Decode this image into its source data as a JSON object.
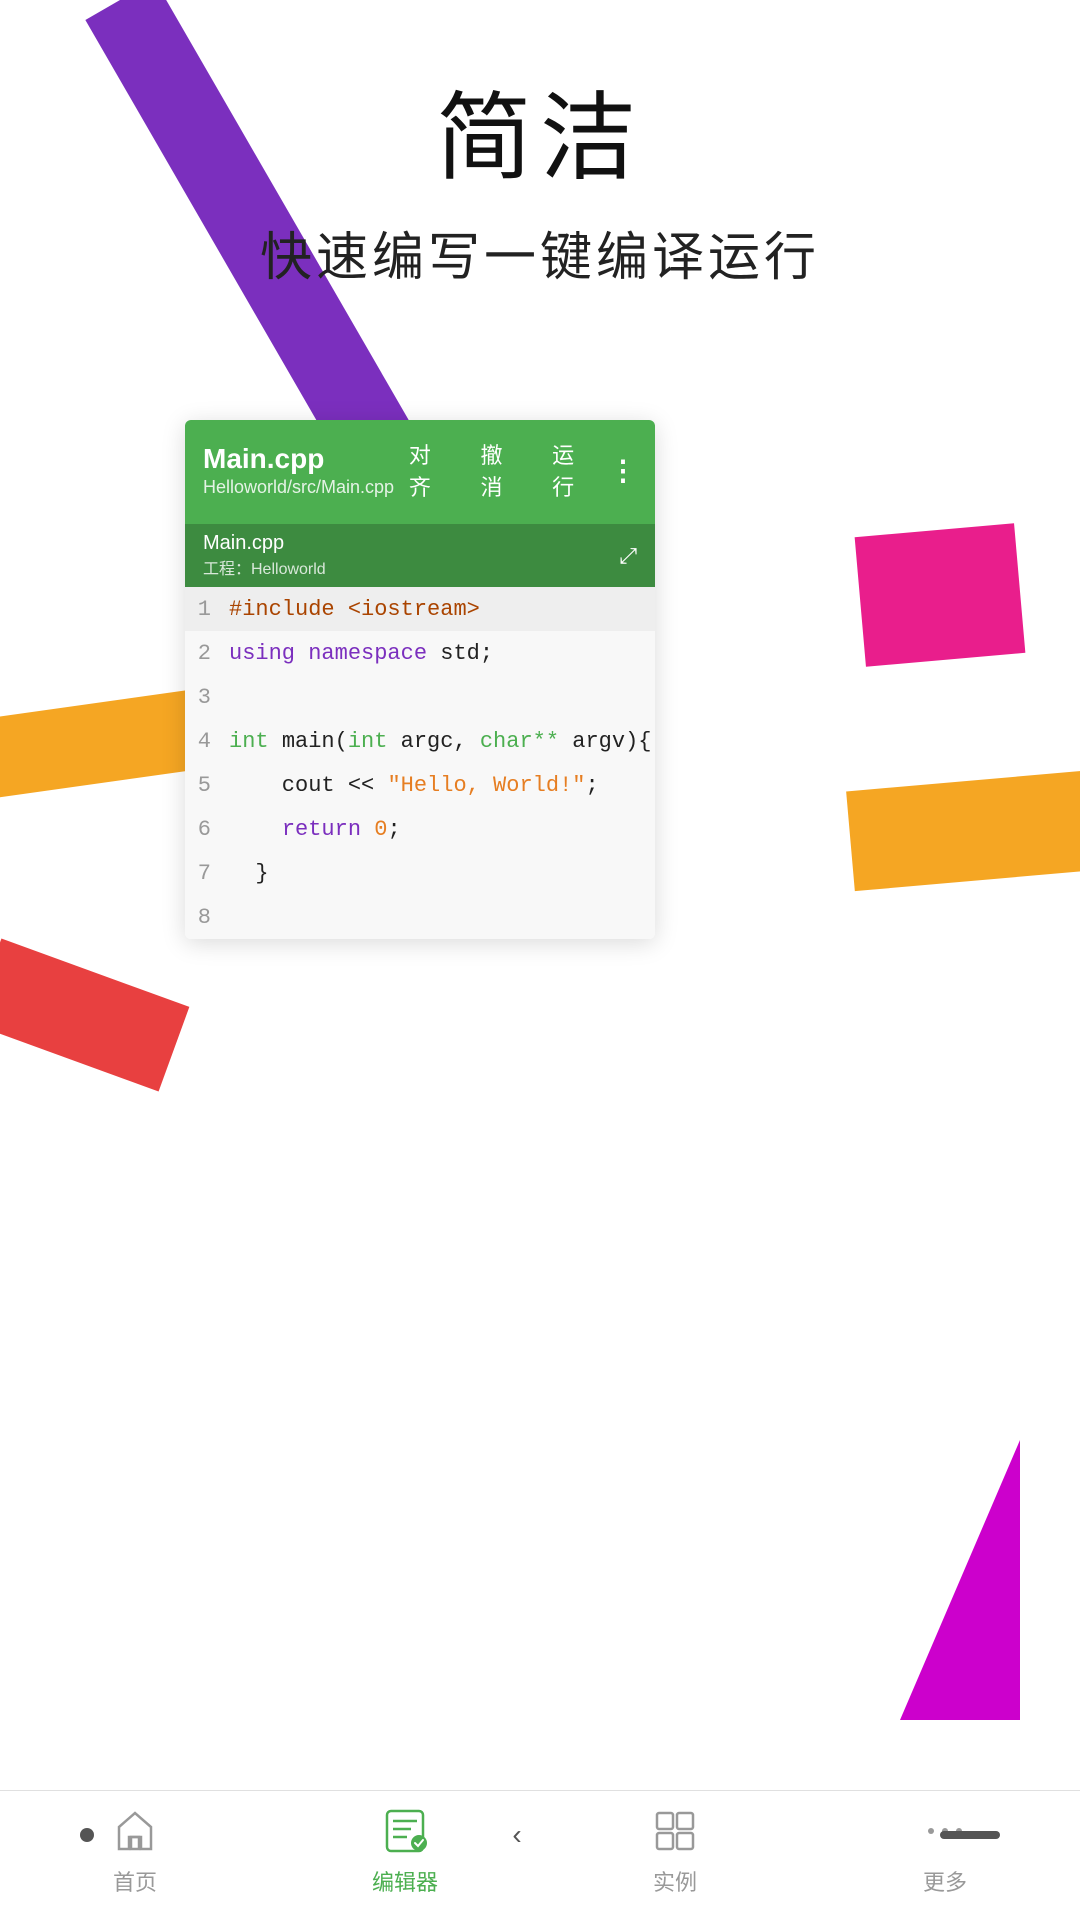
{
  "page": {
    "title": "简洁",
    "subtitle": "快速编写一键编译运行"
  },
  "editor": {
    "filename": "Main.cpp",
    "filepath": "Helloworld/src/Main.cpp",
    "tab_name": "Main.cpp",
    "tab_project": "工程：Helloworld",
    "toolbar_actions": {
      "align": "对齐",
      "undo": "撤消",
      "run": "运行"
    },
    "code_lines": [
      {
        "num": "1",
        "content": "#include <iostream>"
      },
      {
        "num": "2",
        "content": "using namespace std;"
      },
      {
        "num": "3",
        "content": ""
      },
      {
        "num": "4",
        "content": "int main(int argc, char** argv){"
      },
      {
        "num": "5",
        "content": "    cout << \"Hello, World!\";"
      },
      {
        "num": "6",
        "content": "    return 0;"
      },
      {
        "num": "7",
        "content": "  }"
      },
      {
        "num": "8",
        "content": ""
      }
    ]
  },
  "nav": {
    "items": [
      {
        "id": "home",
        "label": "首页",
        "active": false
      },
      {
        "id": "editor",
        "label": "编辑器",
        "active": true
      },
      {
        "id": "examples",
        "label": "实例",
        "active": false
      },
      {
        "id": "more",
        "label": "更多",
        "active": false
      }
    ]
  },
  "colors": {
    "green": "#4CAF50",
    "purple": "#7B2FBE",
    "pink": "#E91E8C",
    "orange": "#F5A623",
    "red": "#E84040",
    "magenta": "#CC00CC"
  }
}
